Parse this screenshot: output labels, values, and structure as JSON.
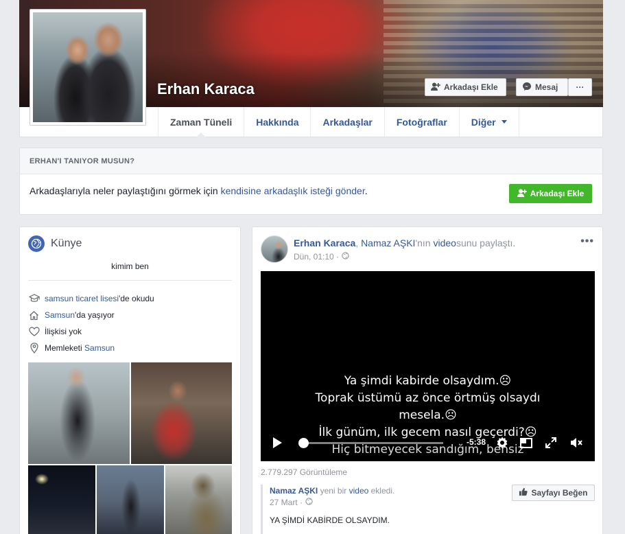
{
  "profile": {
    "name": "Erhan Karaca",
    "add_friend_label": "Arkadaşı Ekle",
    "message_label": "Mesaj",
    "more_label": "···"
  },
  "nav": {
    "tabs": [
      {
        "label": "Zaman Tüneli"
      },
      {
        "label": "Hakkında"
      },
      {
        "label": "Arkadaşlar"
      },
      {
        "label": "Fotoğraflar"
      },
      {
        "label": "Diğer"
      }
    ]
  },
  "know": {
    "header": "ERHAN'I TANIYOR MUSUN?",
    "text_before": "Arkadaşlarıyla neler paylaştığını görmek için ",
    "link": "kendisine arkadaşlık isteği gönder",
    "text_after": ".",
    "button_label": "Arkadaşı Ekle"
  },
  "intro": {
    "title": "Künye",
    "bio": "kimim ben",
    "facts": [
      {
        "link": "samsun ticaret lisesi",
        "text": "'de okudu",
        "icon": "education-icon"
      },
      {
        "link": "Samsun",
        "text": "'da yaşıyor",
        "icon": "home-icon"
      },
      {
        "link": "",
        "text": "İlişkisi yok",
        "icon": "heart-icon"
      },
      {
        "prefix": "Memleketi ",
        "link": "Samsun",
        "text": "",
        "icon": "location-icon"
      }
    ]
  },
  "post": {
    "author": "Erhan Karaca",
    "sep": ", ",
    "shared_from": "Namaz AŞKI",
    "mid": "'nın ",
    "video_word": "video",
    "end": "sunu paylaştı.",
    "time": "Dün, 01:10 ·",
    "menu": "•••",
    "video": {
      "subtitles": [
        "Ya şimdi kabirde olsaydım.☹",
        "Toprak üstümü az önce örtmüş olsaydı",
        "mesela.☹",
        "İlk günüm, ilk gecem nasıl geçerdi?☹",
        "Hiç bitmeyecek sandığım, bensiz"
      ],
      "remaining_time": "-5:38",
      "progress": 0
    },
    "views": "2.779.297 Görüntüleme",
    "shared": {
      "page": "Namaz AŞKI",
      "mid": " yeni bir ",
      "video_word": "video",
      "end": " ekledi.",
      "time": "27 Mart ·",
      "text": "YA ŞİMDİ KABİRDE OLSAYDIM.",
      "like_page_label": "Sayfayı Beğen"
    }
  },
  "colors": {
    "link": "#365899",
    "green_button": "#42b72a",
    "background": "#e9ebee"
  }
}
